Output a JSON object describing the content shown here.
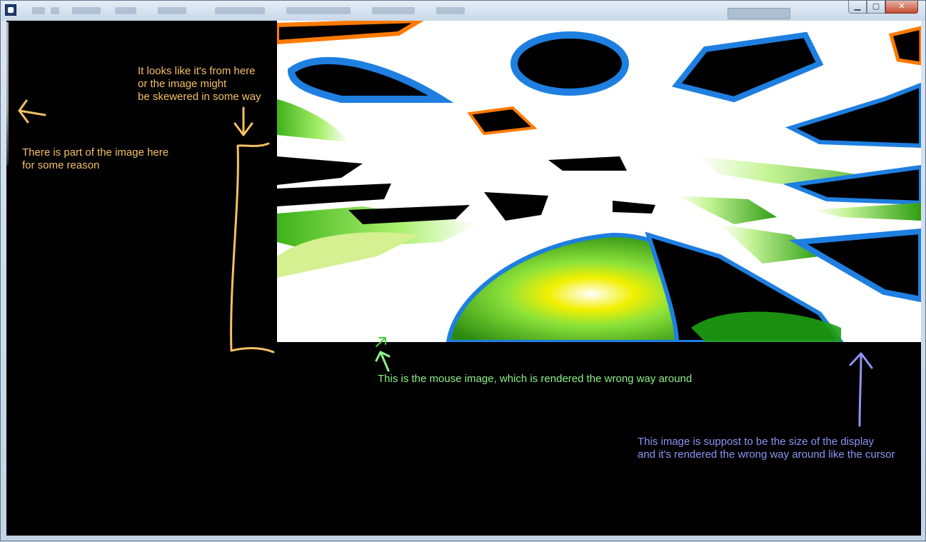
{
  "window": {
    "title_buttons": {
      "minimize_icon": "minimize-icon",
      "maximize_icon": "maximize-icon",
      "close_icon": "close-icon",
      "minimize_glyph": "▁",
      "maximize_glyph": "▢",
      "close_glyph": "✕"
    }
  },
  "annotations": {
    "left_part": "There is part of the image here\nfor some reason",
    "top_source": "It looks like it's from here\nor the image might\nbe skewered in some way",
    "mouse": "This is the mouse image, which is rendered the wrong way around",
    "display_size": "This image is suppost to be the size of the display\nand it's rendered the wrong way around like the cursor"
  },
  "colors": {
    "annotation_orange": "#f5c065",
    "annotation_green": "#8ff08a",
    "annotation_blue": "#8e95f5",
    "viewport_background": "#000000"
  }
}
